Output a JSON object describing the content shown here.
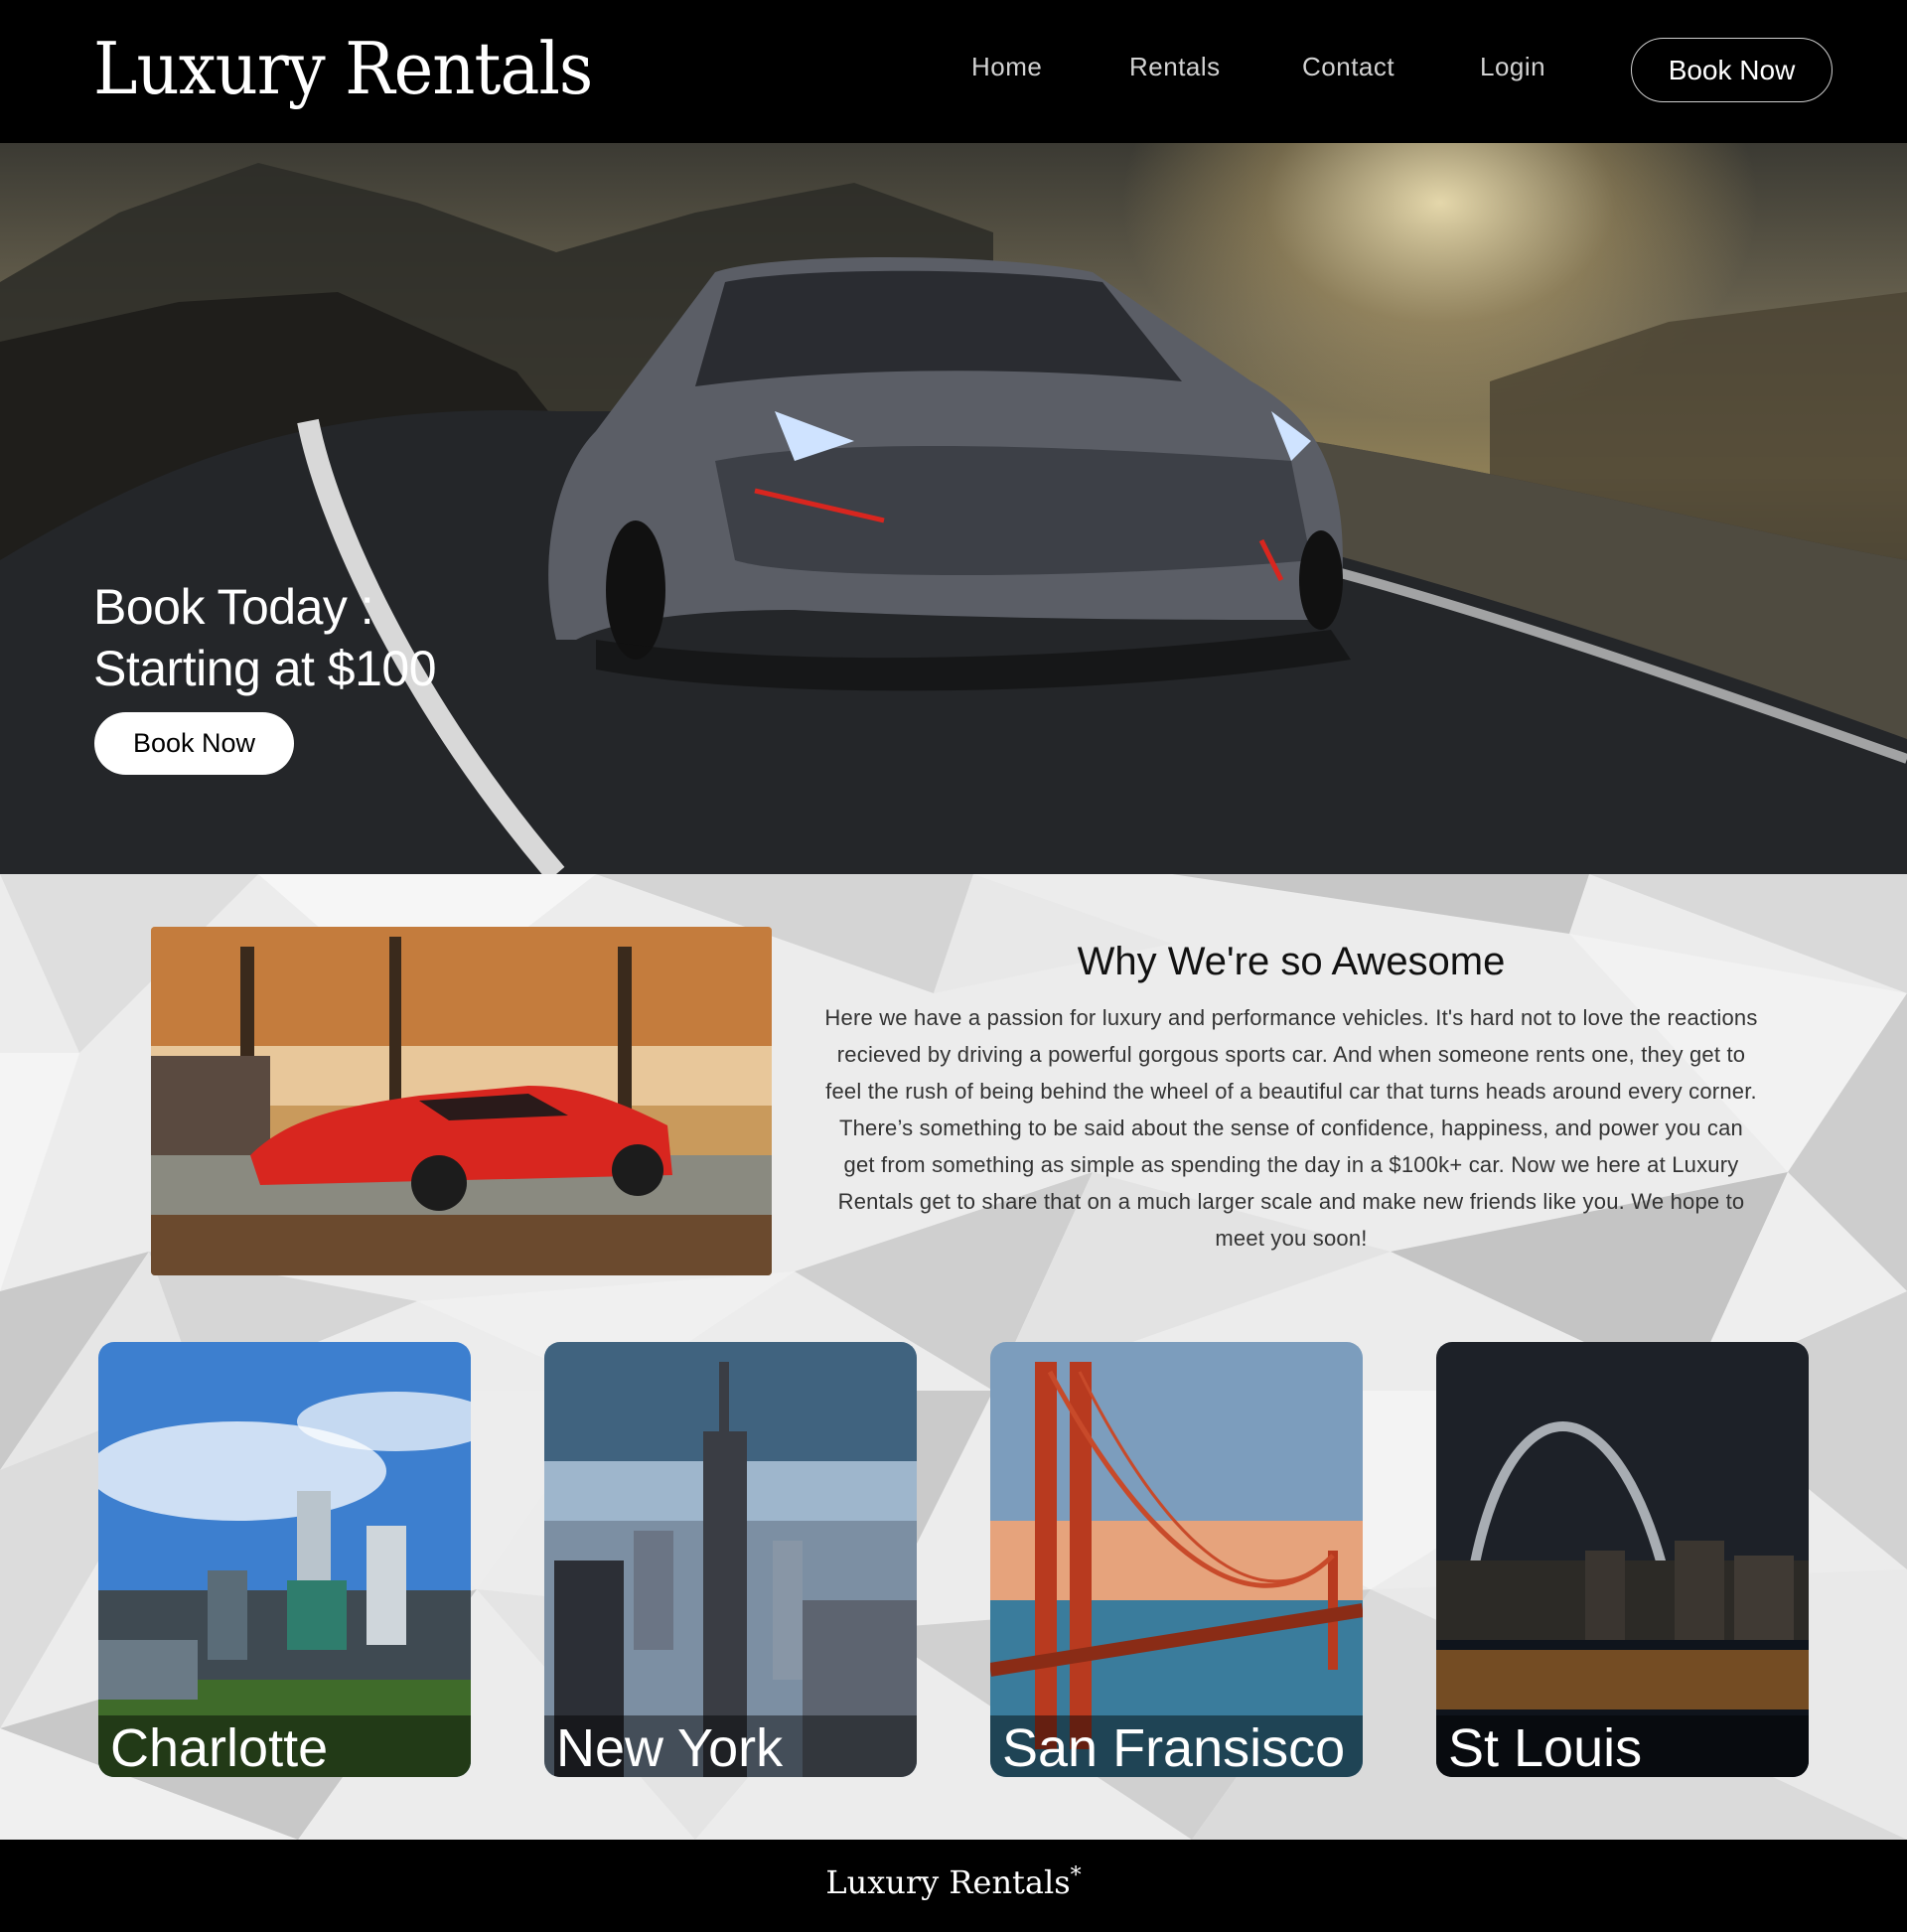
{
  "header": {
    "logo": "Luxury Rentals",
    "nav": [
      "Home",
      "Rentals",
      "Contact",
      "Login"
    ],
    "book_button": "Book Now"
  },
  "hero": {
    "title_line1": "Book Today :",
    "title_line2": "Starting at $100",
    "book_button": "Book Now"
  },
  "about": {
    "title": "Why We're so Awesome",
    "text": "Here we have a passion for luxury and performance vehicles. It's hard not to love the reactions recieved by driving a powerful gorgous sports car. And when someone rents one, they get to feel the rush of being behind the wheel of a beautiful car that turns heads around every corner. There’s something to be said about the sense of confidence, happiness, and power you can get from something as simple as spending the day in a $100k+ car. Now we here at Luxury Rentals get to share that on a much larger scale and make new friends like you. We hope to meet you soon!"
  },
  "cities": [
    {
      "name": "Charlotte"
    },
    {
      "name": "New York"
    },
    {
      "name": "San Fransisco"
    },
    {
      "name": "St Louis"
    }
  ],
  "footer": {
    "logo": "Luxury Rentals",
    "mark": "*"
  },
  "colors": {
    "header_bg": "#000000",
    "content_bg": "#ececec",
    "accent_red": "#d8261f"
  }
}
